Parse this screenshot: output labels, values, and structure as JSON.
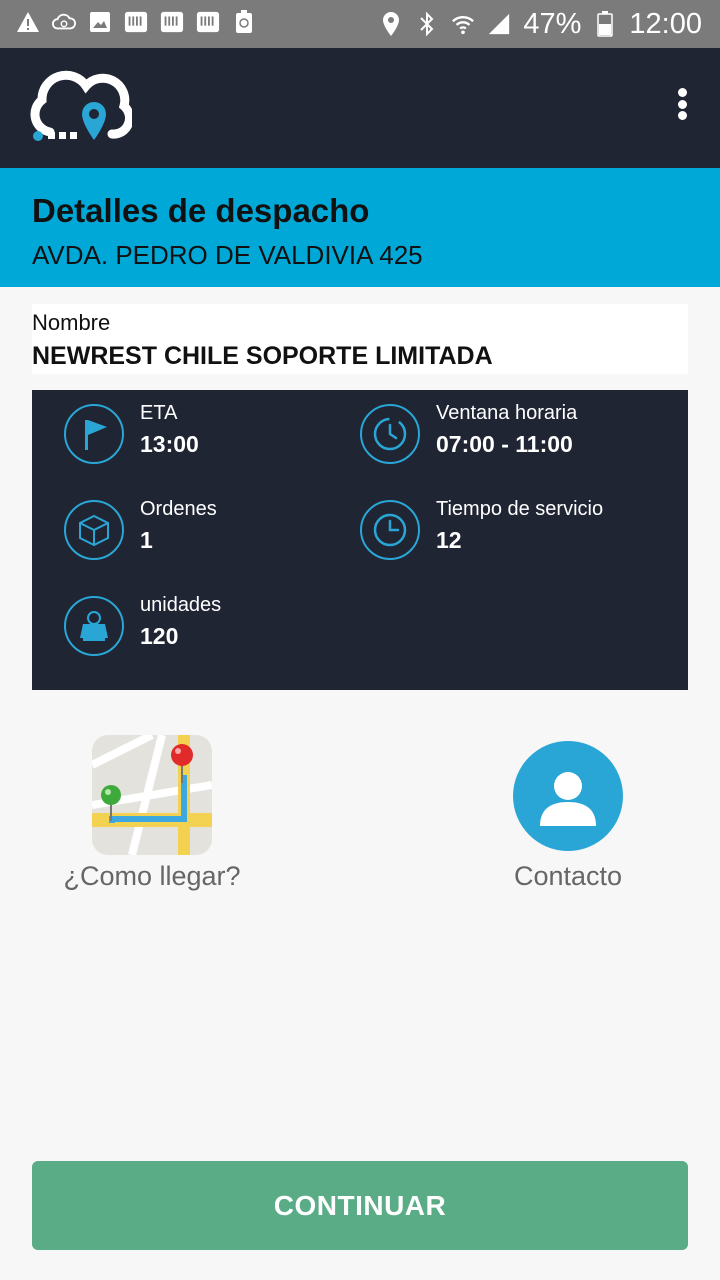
{
  "status_bar": {
    "battery": "47%",
    "time": "12:00",
    "left_icons": [
      "warning-icon",
      "cloud-sync-icon",
      "image-icon",
      "keyboard-icon",
      "keyboard-icon",
      "keyboard-icon",
      "recycle-battery-icon"
    ],
    "right_icons": [
      "location-icon",
      "bluetooth-icon",
      "wifi-icon",
      "signal-icon",
      "battery-icon"
    ]
  },
  "app_bar": {
    "logo": "cloud-location-logo",
    "menu": "more-vert-icon"
  },
  "header": {
    "title": "Detalles de despacho",
    "address": "AVDA. PEDRO DE VALDIVIA 425"
  },
  "name_card": {
    "label": "Nombre",
    "value": "NEWREST CHILE SOPORTE LIMITADA"
  },
  "details": [
    {
      "icon": "flag-icon",
      "label": "ETA",
      "value": "13:00"
    },
    {
      "icon": "clock-window-icon",
      "label": "Ventana horaria",
      "value": "07:00 - 11:00"
    },
    {
      "icon": "box-icon",
      "label": "Ordenes",
      "value": "1"
    },
    {
      "icon": "clock-icon",
      "label": "Tiempo de servicio",
      "value": "12"
    },
    {
      "icon": "scale-icon",
      "label": "unidades",
      "value": "120"
    }
  ],
  "actions": {
    "directions_label": "¿Como llegar?",
    "contact_label": "Contacto"
  },
  "continue_label": "CONTINUAR",
  "colors": {
    "status_bar": "#7b7b7b",
    "app_bar": "#1f2533",
    "header": "#00a8d8",
    "accent": "#2aa6d6",
    "continue": "#5aac87"
  }
}
